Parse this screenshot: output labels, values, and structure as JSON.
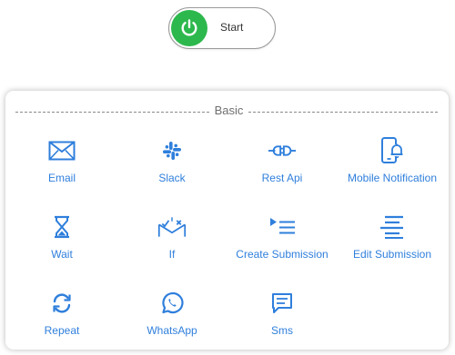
{
  "start": {
    "label": "Start",
    "accent": "#2db84d",
    "icon": "power-icon"
  },
  "palette": {
    "section_title": "Basic",
    "accent": "#2f7fdc",
    "items": [
      {
        "label": "Email",
        "icon": "envelope-icon"
      },
      {
        "label": "Slack",
        "icon": "slack-icon"
      },
      {
        "label": "Rest Api",
        "icon": "plug-icon"
      },
      {
        "label": "Mobile Notification",
        "icon": "mobile-bell-icon"
      },
      {
        "label": "Wait",
        "icon": "hourglass-icon"
      },
      {
        "label": "If",
        "icon": "branch-icon"
      },
      {
        "label": "Create Submission",
        "icon": "list-play-icon"
      },
      {
        "label": "Edit Submission",
        "icon": "align-edit-icon"
      },
      {
        "label": "Repeat",
        "icon": "repeat-icon"
      },
      {
        "label": "WhatsApp",
        "icon": "whatsapp-icon"
      },
      {
        "label": "Sms",
        "icon": "sms-icon"
      }
    ]
  }
}
